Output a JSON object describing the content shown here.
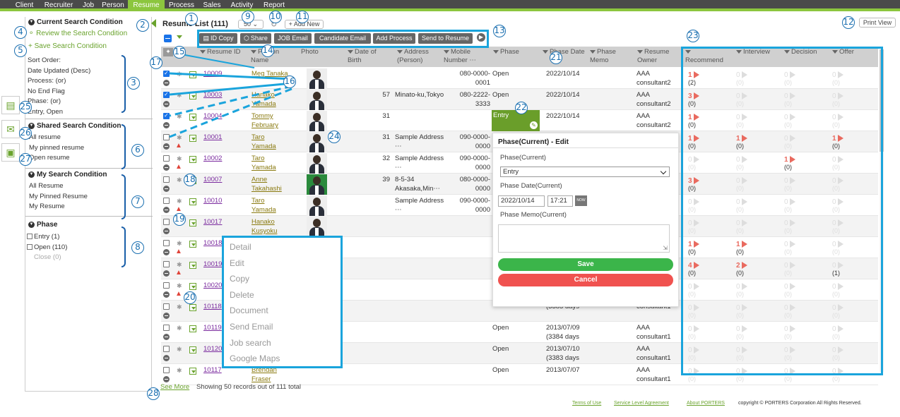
{
  "nav": [
    "Client",
    "Recruiter",
    "Job",
    "Person",
    "Resume",
    "Process",
    "Sales",
    "Activity",
    "Report"
  ],
  "nav_active": "Resume",
  "sidebar": {
    "current_title": "Current Search Condition",
    "review_link": "Review the Search Condition",
    "save_link": "Save Search Condition",
    "condition_lines": [
      "Sort Order:",
      "Date Updated (Desc)",
      "Process: (or)",
      "No End Flag",
      "Phase: (or)",
      "Entry, Open"
    ],
    "shared_title": "Shared Search Condition",
    "shared_items": [
      "All resume",
      "My pinned resume",
      "Open resume"
    ],
    "my_title": "My Search Condition",
    "my_items": [
      "All Resume",
      "My Pinned Resume",
      "My Resume"
    ],
    "phase_title": "Phase",
    "phase_items": [
      "Entry (1)",
      "Open (110)",
      "Close (0)"
    ]
  },
  "list": {
    "title": "Resume List (111)",
    "page_size": "50",
    "add_new": "+ Add New",
    "print_view": "Print View"
  },
  "toolbar": [
    "ID Copy",
    "Share",
    "JOB Email",
    "Candidate Email",
    "Add Process",
    "Send to Resume"
  ],
  "columns": {
    "resume_id": "Resume ID",
    "person_name": "Person Name",
    "photo": "Photo",
    "dob": "Date of Birth",
    "address": "Address (Person)",
    "mobile": "Mobile Number ⋯",
    "phase": "Phase",
    "phase_date": "Phase Date",
    "phase_memo": "Phase Memo",
    "owner": "Resume Owner",
    "recommend": "Recommend",
    "interview": "Interview",
    "decision": "Decision",
    "offer": "Offer"
  },
  "rows": [
    {
      "id": "10009",
      "name": "Meg Tanaka",
      "age": "",
      "addr": "",
      "mobile": "080-0000-0001",
      "phase": "Open",
      "date": "2022/10/14",
      "owner": "AAA consultant2",
      "checked": true
    },
    {
      "id": "10003",
      "name": "Hanako Yamada",
      "age": "57",
      "addr": "Minato-ku,Tokyo",
      "mobile": "080-2222-3333",
      "phase": "Open",
      "date": "2022/10/14",
      "owner": "AAA consultant2",
      "checked": true
    },
    {
      "id": "10004",
      "name": "Tommy February",
      "age": "31",
      "addr": "",
      "mobile": "",
      "phase": "Entry",
      "date": "2022/10/14",
      "owner": "AAA consultant2",
      "checked": true
    },
    {
      "id": "10001",
      "name": "Taro Yamada",
      "age": "31",
      "addr": "Sample Address ⋯",
      "mobile": "090-0000-0000",
      "phase": "",
      "date": "",
      "owner": "",
      "checked": false
    },
    {
      "id": "10002",
      "name": "Taro Yamada",
      "age": "32",
      "addr": "Sample Address ⋯",
      "mobile": "090-0000-0000",
      "phase": "",
      "date": "",
      "owner": "",
      "checked": false
    },
    {
      "id": "10007",
      "name": "Anne Takahashi",
      "age": "39",
      "addr": "8-5-34 Akasaka,Min⋯",
      "mobile": "080-0000-0000",
      "phase": "",
      "date": "",
      "owner": "",
      "checked": false
    },
    {
      "id": "10010",
      "name": "Taro Yamada",
      "age": "",
      "addr": "Sample Address ⋯",
      "mobile": "090-0000-0000",
      "phase": "",
      "date": "",
      "owner": "",
      "checked": false
    },
    {
      "id": "10017",
      "name": "Hanako Kusyoku",
      "age": "",
      "addr": "",
      "mobile": "",
      "phase": "",
      "date": "",
      "owner": "",
      "checked": false
    },
    {
      "id": "10018",
      "name": "",
      "age": "",
      "addr": "",
      "mobile": "",
      "phase": "",
      "date": "",
      "owner": "",
      "checked": false
    },
    {
      "id": "10019",
      "name": "",
      "age": "",
      "addr": "",
      "mobile": "",
      "phase": "",
      "date": "",
      "owner": "",
      "checked": false
    },
    {
      "id": "10020",
      "name": "",
      "age": "",
      "addr": "",
      "mobile": "",
      "phase": "",
      "date": "",
      "owner": "",
      "checked": false
    },
    {
      "id": "10118",
      "name": "",
      "age": "",
      "addr": "",
      "mobile": "",
      "phase": "",
      "date": "(3385 days",
      "owner": "consultant1",
      "checked": false
    },
    {
      "id": "10119",
      "name": "",
      "age": "",
      "addr": "",
      "mobile": "",
      "phase": "Open",
      "date": "2013/07/09 (3384 days",
      "owner": "AAA consultant1",
      "checked": false
    },
    {
      "id": "10120",
      "name": "",
      "age": "",
      "addr": "",
      "mobile": "",
      "phase": "Open",
      "date": "2013/07/10 (3383 days",
      "owner": "AAA consultant1",
      "checked": false
    },
    {
      "id": "10117",
      "name": "Brendan Fraser",
      "age": "",
      "addr": "",
      "mobile": "",
      "phase": "Open",
      "date": "2013/07/07",
      "owner": "AAA consultant1",
      "checked": false
    }
  ],
  "process": [
    [
      {
        "v": "1",
        "c": "(2)"
      },
      {
        "v": "0",
        "c": "(0)"
      },
      {
        "v": "0",
        "c": "(0)"
      },
      {
        "v": "0",
        "c": "(0)"
      }
    ],
    [
      {
        "v": "3",
        "c": "(0)"
      },
      {
        "v": "0",
        "c": "(0)"
      },
      {
        "v": "0",
        "c": "(0)"
      },
      {
        "v": "0",
        "c": "(0)"
      }
    ],
    [
      {
        "v": "1",
        "c": "(0)"
      },
      {
        "v": "0",
        "c": "(0)"
      },
      {
        "v": "0",
        "c": "(0)"
      },
      {
        "v": "0",
        "c": "(0)"
      }
    ],
    [
      {
        "v": "1",
        "c": "(0)"
      },
      {
        "v": "1",
        "c": "(0)"
      },
      {
        "v": "0",
        "c": "(0)"
      },
      {
        "v": "1",
        "c": "(0)"
      }
    ],
    [
      {
        "v": "0",
        "c": "(0)"
      },
      {
        "v": "0",
        "c": "(0)"
      },
      {
        "v": "1",
        "c": "(0)"
      },
      {
        "v": "0",
        "c": "(0)"
      }
    ],
    [
      {
        "v": "3",
        "c": "(0)"
      },
      {
        "v": "0",
        "c": "(0)"
      },
      {
        "v": "0",
        "c": "(0)"
      },
      {
        "v": "0",
        "c": "(0)"
      }
    ],
    [
      {
        "v": "0",
        "c": "(0)"
      },
      {
        "v": "0",
        "c": "(0)"
      },
      {
        "v": "0",
        "c": "(0)"
      },
      {
        "v": "0",
        "c": "(0)"
      }
    ],
    [
      {
        "v": "0",
        "c": "(0)"
      },
      {
        "v": "0",
        "c": "(0)"
      },
      {
        "v": "0",
        "c": "(0)"
      },
      {
        "v": "0",
        "c": "(0)"
      }
    ],
    [
      {
        "v": "1",
        "c": "(0)"
      },
      {
        "v": "1",
        "c": "(0)"
      },
      {
        "v": "0",
        "c": "(0)"
      },
      {
        "v": "0",
        "c": "(0)"
      }
    ],
    [
      {
        "v": "4",
        "c": "(0)"
      },
      {
        "v": "2",
        "c": "(0)"
      },
      {
        "v": "0",
        "c": "(0)"
      },
      {
        "v": "0",
        "c": "(1)"
      }
    ],
    [
      {
        "v": "0",
        "c": "(0)"
      },
      {
        "v": "0",
        "c": "(0)"
      },
      {
        "v": "0",
        "c": "(0)"
      },
      {
        "v": "0",
        "c": "(0)"
      }
    ],
    [
      {
        "v": "0",
        "c": "(0)"
      },
      {
        "v": "0",
        "c": "(0)"
      },
      {
        "v": "0",
        "c": "(0)"
      },
      {
        "v": "0",
        "c": "(0)"
      }
    ],
    [
      {
        "v": "0",
        "c": "(0)"
      },
      {
        "v": "0",
        "c": "(0)"
      },
      {
        "v": "0",
        "c": "(0)"
      },
      {
        "v": "0",
        "c": "(0)"
      }
    ],
    [
      {
        "v": "0",
        "c": "(0)"
      },
      {
        "v": "0",
        "c": "(0)"
      },
      {
        "v": "0",
        "c": "(0)"
      },
      {
        "v": "0",
        "c": "(0)"
      }
    ],
    [
      {
        "v": "0",
        "c": "(0)"
      },
      {
        "v": "0",
        "c": "(0)"
      },
      {
        "v": "0",
        "c": "(0)"
      },
      {
        "v": "0",
        "c": "(0)"
      }
    ]
  ],
  "context_menu": [
    "Detail",
    "Edit",
    "Copy",
    "Delete",
    "Document",
    "Send Email",
    "Job search",
    "Google Maps"
  ],
  "phase_popup": {
    "title": "Phase(Current) - Edit",
    "phase_label": "Phase(Current)",
    "phase_value": "Entry",
    "date_label": "Phase Date(Current)",
    "date_value": "2022/10/14",
    "time_value": "17:21",
    "now": "NOW",
    "memo_label": "Phase Memo(Current)",
    "save": "Save",
    "cancel": "Cancel"
  },
  "footer": {
    "see_more": "See More",
    "showing": "Showing 50 records out of 111 total",
    "terms": "Terms of Use",
    "sla": "Service Level Agreement",
    "about": "About PORTERS",
    "copyright": "copyright © PORTERS Corporation All Rights Reserved."
  },
  "annotations": [
    "1",
    "2",
    "3",
    "4",
    "5",
    "6",
    "7",
    "8",
    "9",
    "10",
    "11",
    "12",
    "13",
    "14",
    "15",
    "16",
    "17",
    "18",
    "19",
    "20",
    "21",
    "22",
    "23",
    "24",
    "25",
    "26",
    "27",
    "28"
  ],
  "colors": {
    "accent": "#8cc63e",
    "annotation": "#1aa4dc",
    "save": "#3bb54a",
    "cancel": "#f0524f",
    "pending": "#e96a5f"
  }
}
